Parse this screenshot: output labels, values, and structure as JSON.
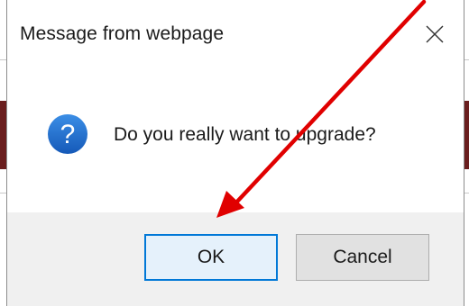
{
  "dialog": {
    "title": "Message from webpage",
    "message": "Do you really want to upgrade?",
    "icon": "question-icon",
    "buttons": {
      "ok_label": "OK",
      "cancel_label": "Cancel"
    }
  },
  "annotation": {
    "type": "arrow",
    "color": "#e00000",
    "points_to": "ok-button"
  },
  "colors": {
    "accent": "#0078d7",
    "footer_bg": "#f0f0f0",
    "icon_blue": "#1d6fd1"
  }
}
